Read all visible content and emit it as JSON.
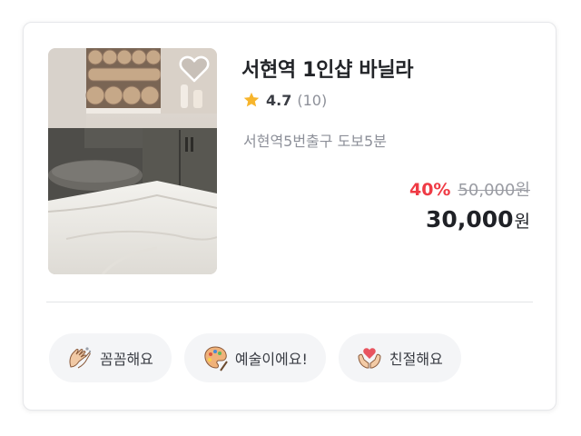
{
  "product": {
    "title": "서현역 1인샵 바닐라",
    "rating": "4.7",
    "review_count": "(10)",
    "location": "서현역5번출구 도보5분",
    "discount": "40%",
    "original_price": "50,000원",
    "price": "30,000",
    "price_unit": "원",
    "favorite_icon": "heart-outline-icon"
  },
  "tags": [
    {
      "label": "꼼꼼해요",
      "icon": "hands-icon"
    },
    {
      "label": "예술이에요!",
      "icon": "art-icon"
    },
    {
      "label": "친절해요",
      "icon": "heart-hands-icon"
    }
  ],
  "colors": {
    "discount": "#ef3b45",
    "star": "#f7b52c",
    "muted_text": "#8d9099",
    "tag_background": "#f4f5f7"
  }
}
